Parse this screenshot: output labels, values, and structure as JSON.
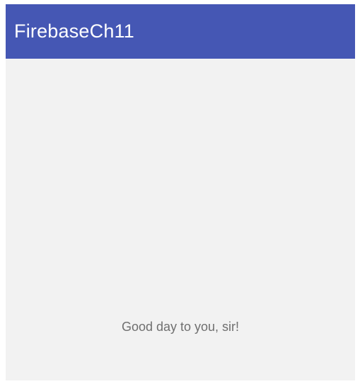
{
  "app_bar": {
    "title": "FirebaseCh11"
  },
  "content": {
    "message": "Good day to you, sir!"
  },
  "colors": {
    "app_bar": "#4557b4",
    "background": "#f2f2f2",
    "message_text": "#6f6f6f",
    "title_text": "#ffffff"
  }
}
